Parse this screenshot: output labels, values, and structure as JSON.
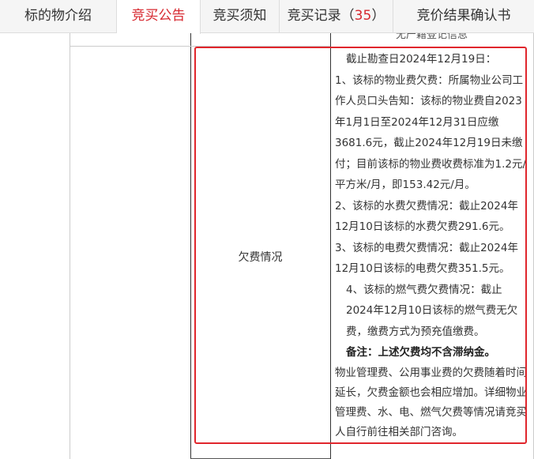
{
  "tabs": [
    {
      "label": "标的物介绍"
    },
    {
      "label": "竞买公告"
    },
    {
      "label": "竞买须知"
    },
    {
      "label": "竞买记录（",
      "count": "35",
      "suffix": "）"
    },
    {
      "label": "竞价结果确认书"
    }
  ],
  "colors": {
    "accent": "#d7282f",
    "highlight": "#e0262c"
  },
  "table": {
    "cut_text": "无产籍登记信息",
    "row_label": "欠费情况",
    "content": {
      "intro": "截止勘查日2024年12月19日：",
      "p1": "1、该标的物业费欠费：所属物业公司工作人员口头告知：该标的物业费自2023年1月1日至2024年12月31日应缴3681.6元，截止2024年12月19日未缴付；目前该标的物业费收费标准为1.2元/平方米/月，即153.42元/月。",
      "p2": "2、该标的水费欠费情况：截止2024年12月10日该标的水费欠费291.6元。",
      "p3": "3、该标的电费欠费情况：截止2024年12月10日该标的电费欠费351.5元。",
      "p4": "4、该标的燃气费欠费情况：截止2024年12月10日该标的燃气费无欠费，缴费方式为预充值缴费。",
      "note": "备注：上述欠费均不含滞纳金。",
      "p5": "物业管理费、公用事业费的欠费随着时间延长，欠费金额也会相应增加。详细物业管理费、水、电、燃气欠费等情况请竞买人自行前往相关部门咨询。"
    }
  }
}
